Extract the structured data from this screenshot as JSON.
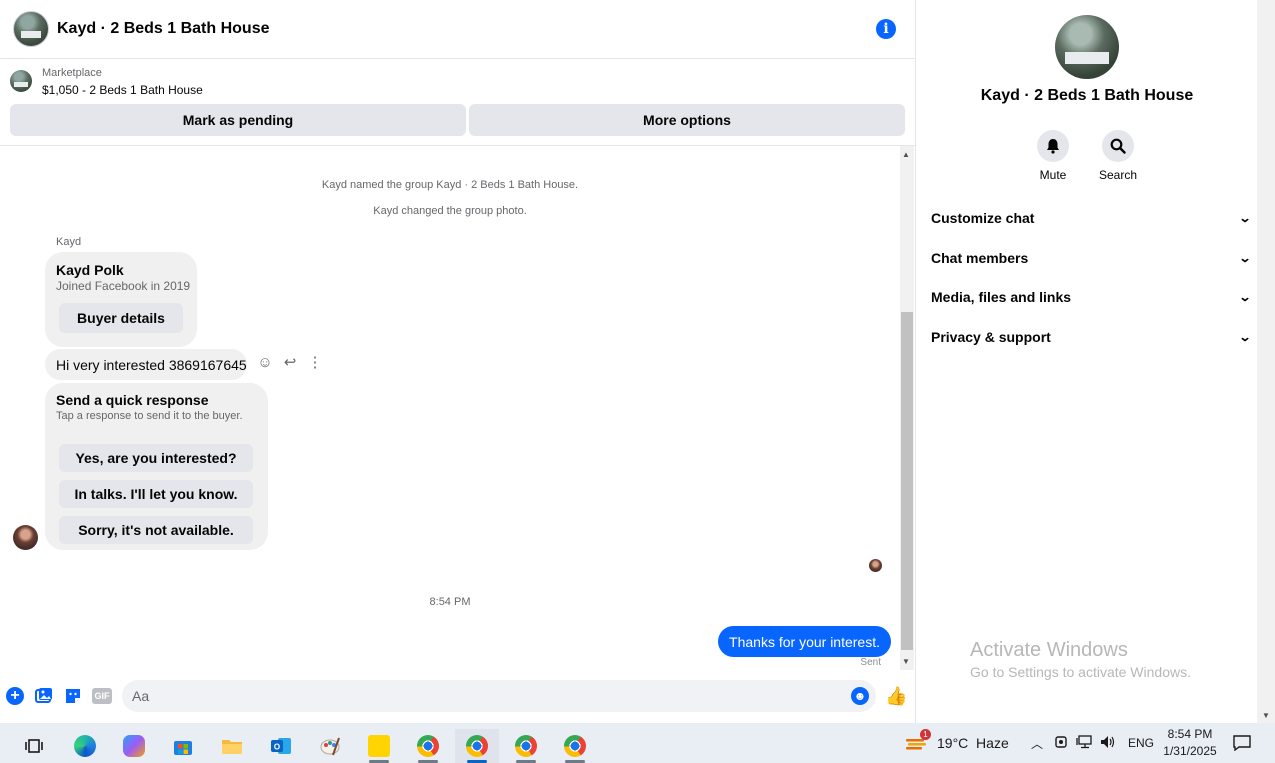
{
  "chat": {
    "title": "Kayd · 2 Beds 1 Bath House",
    "marketplace_label": "Marketplace",
    "listing": "$1,050 - 2 Beds 1 Bath House",
    "mark_pending_label": "Mark as pending",
    "more_options_label": "More options"
  },
  "messages": {
    "system_1": "Kayd named the group Kayd · 2 Beds 1 Bath House.",
    "system_2": "Kayd changed the group photo.",
    "sender_name": "Kayd",
    "profile_name": "Kayd Polk",
    "profile_joined": "Joined Facebook in 2019",
    "buyer_details_label": "Buyer details",
    "incoming_text": "Hi very interested 3869167645",
    "quick_title": "Send a quick response",
    "quick_subtitle": "Tap a response to send it to the buyer.",
    "quick_responses": [
      "Yes, are you interested?",
      "In talks. I'll let you know.",
      "Sorry, it's not available."
    ],
    "timestamp": "8:54 PM",
    "outgoing_text": "Thanks for your interest.",
    "sent_status": "Sent"
  },
  "composer": {
    "placeholder": "Aa",
    "gif_label": "GIF"
  },
  "sidebar": {
    "title": "Kayd · 2 Beds 1 Bath House",
    "mute_label": "Mute",
    "search_label": "Search",
    "sections": [
      "Customize chat",
      "Chat members",
      "Media, files and links",
      "Privacy & support"
    ]
  },
  "watermark": {
    "title": "Activate Windows",
    "subtitle": "Go to Settings to activate Windows."
  },
  "taskbar": {
    "weather_badge": "1",
    "weather": "19°C  Haze",
    "language": "ENG",
    "time": "8:54 PM",
    "date": "1/31/2025"
  },
  "colors": {
    "accent": "#0866ff",
    "bubble_in": "#f0f0f0",
    "button_grey": "#e4e6eb"
  },
  "icons": [
    "info-icon",
    "smile-icon",
    "reply-icon",
    "more-vertical-icon",
    "plus-icon",
    "photo-icon",
    "sticker-icon",
    "gif-icon",
    "emoji-icon",
    "thumbs-up-icon",
    "bell-icon",
    "search-icon",
    "chevron-down-icon"
  ]
}
